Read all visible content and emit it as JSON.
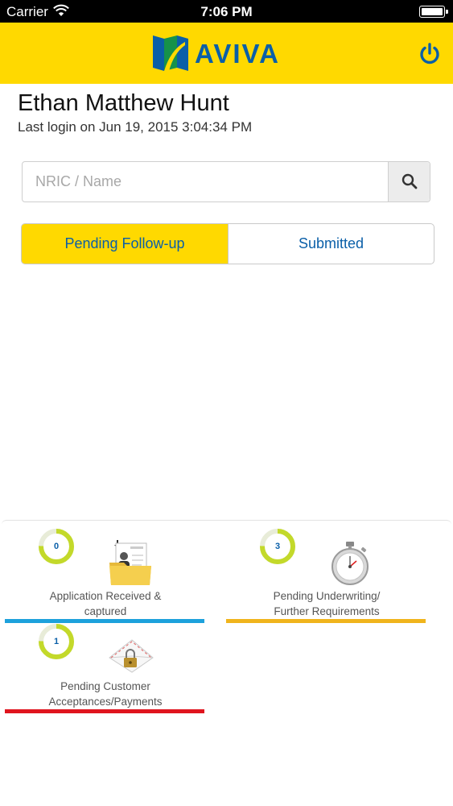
{
  "status_bar": {
    "carrier": "Carrier",
    "time": "7:06 PM"
  },
  "header": {
    "brand": "AVIVA",
    "brand_color": "#0a5fa8",
    "background_color": "#ffd900",
    "logout_icon": "power-icon"
  },
  "user": {
    "name": "Ethan Matthew Hunt",
    "last_login": "Last login on Jun 19, 2015 3:04:34 PM"
  },
  "search": {
    "placeholder": "NRIC / Name",
    "value": "",
    "icon": "search-icon"
  },
  "tabs": [
    {
      "label": "Pending Follow-up",
      "active": true
    },
    {
      "label": "Submitted",
      "active": false
    }
  ],
  "status_cards": [
    {
      "count": "0",
      "label_line1": "Application Received &",
      "label_line2": "captured",
      "bar_color": "#1da1dc",
      "icon": "proposal-folder-icon"
    },
    {
      "count": "3",
      "label_line1": "Pending Underwriting/",
      "label_line2": "Further Requirements",
      "bar_color": "#f0b41c",
      "icon": "stopwatch-icon"
    },
    {
      "count": "1",
      "label_line1": "Pending Customer",
      "label_line2": "Acceptances/Payments",
      "bar_color": "#e0141e",
      "icon": "locked-envelope-icon"
    }
  ]
}
